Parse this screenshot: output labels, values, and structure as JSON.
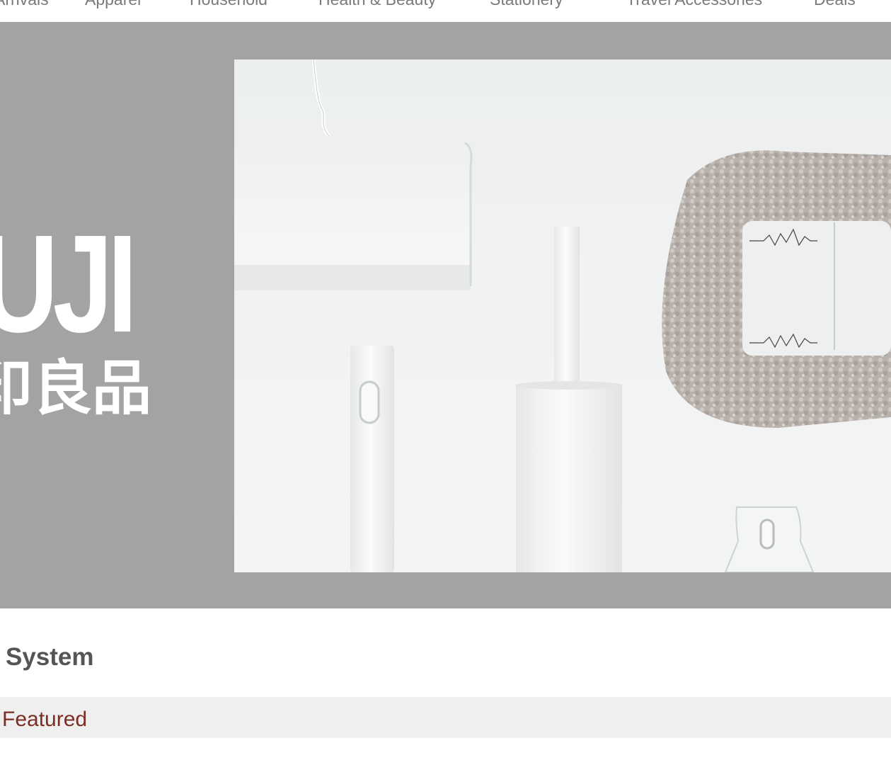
{
  "nav": {
    "items": [
      {
        "label": "Arrivals"
      },
      {
        "label": "Apparel"
      },
      {
        "label": "Household"
      },
      {
        "label": "Health & Beauty"
      },
      {
        "label": "Stationery"
      },
      {
        "label": "Travel Accessories"
      },
      {
        "label": "Deals"
      }
    ]
  },
  "hero": {
    "logo_latin": "UJI",
    "logo_kanji": "印良品",
    "background_color": "#a3a3a3",
    "photo_alt": "white cleaning system tools: duster, brush holders, hooks"
  },
  "main": {
    "section_title": "System",
    "tabs": [
      {
        "label": "Featured",
        "active": true
      }
    ]
  },
  "colors": {
    "accent": "#7b2e23",
    "text_muted": "#7a7a7a",
    "heading": "#555555",
    "tab_bar_bg": "#efefef"
  }
}
